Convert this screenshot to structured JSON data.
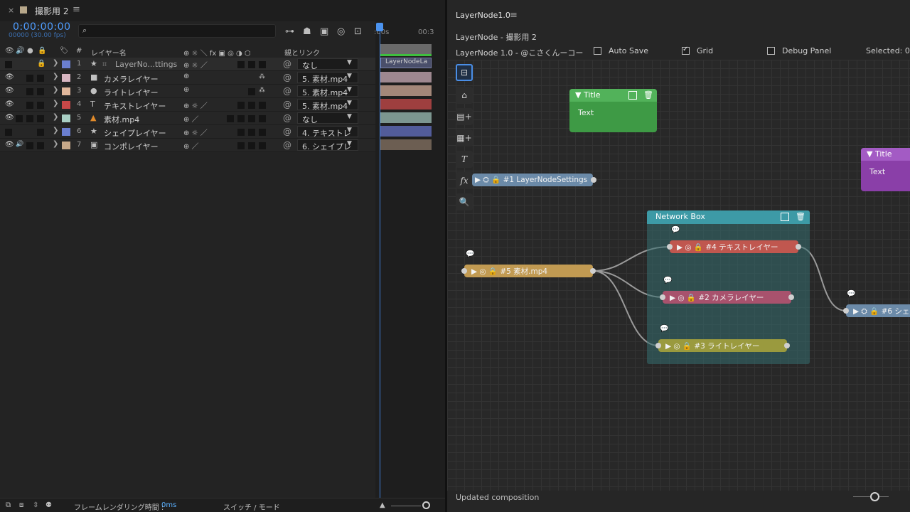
{
  "timeline": {
    "tab_close": "×",
    "tab_title": "撮影用 2",
    "tab_menu": "≡",
    "timecode": "0:00:00:00",
    "fps": "00000 (30.00 fps)",
    "header": {
      "eye": "👁",
      "audio": "🔊",
      "solo": "●",
      "lock": "🔒",
      "label": "🏷",
      "number": "#",
      "layer_name": "レイヤー名",
      "switches": "⊕ ☼ ＼ fx ▣ ◎ ◑ ⬡",
      "parent": "親とリンク"
    },
    "layers": [
      {
        "num": "1",
        "color": "#6b7fd0",
        "type_icon": "★",
        "type2": "⌗",
        "name": "LayerNo...ttings",
        "parent": "なし",
        "eye": "",
        "switch": "⊕ ☼ ／"
      },
      {
        "num": "2",
        "color": "#d8b6c2",
        "type_icon": "■",
        "name": "カメラレイヤー",
        "parent": "5. 素材.mp4",
        "eye": "👁",
        "switch": "⊕"
      },
      {
        "num": "3",
        "color": "#e1b79c",
        "type_icon": "●",
        "name": "ライトレイヤー",
        "parent": "5. 素材.mp4",
        "eye": "👁",
        "switch": "⊕"
      },
      {
        "num": "4",
        "color": "#c94848",
        "type_icon": "T",
        "name": "テキストレイヤー",
        "parent": "5. 素材.mp4",
        "eye": "👁",
        "switch": "⊕ ☼ ／"
      },
      {
        "num": "5",
        "color": "#a9cfc4",
        "type_icon": "▲",
        "name": "素材.mp4",
        "parent": "なし",
        "eye": "👁",
        "switch": "⊕   ／"
      },
      {
        "num": "6",
        "color": "#6b7fd0",
        "type_icon": "★",
        "name": "シェイプレイヤー",
        "parent": "4. テキストレ",
        "eye": "",
        "switch": "⊕ ☼ ／"
      },
      {
        "num": "7",
        "color": "#c7a98a",
        "type_icon": "▣",
        "name": "コンポレイヤー",
        "parent": "6. シェイプレ",
        "eye": "👁",
        "switch": "⊕   ／"
      }
    ],
    "ruler": {
      "t0": ":00s",
      "t1": "00:3"
    },
    "track_label": "LayerNodeLa",
    "bottom": {
      "render_label": "フレームレンダリング時間 :",
      "render_value": "0ms",
      "switch_mode": "スイッチ / モード"
    }
  },
  "editor": {
    "title": "LayerNode1.0",
    "menu": "≡",
    "comp_name": "LayerNode - 撮影用 2",
    "credit": "LayerNode 1.0 - @こさくんーコー",
    "auto_save": "Auto Save",
    "grid": "Grid",
    "debug_panel": "Debug Panel",
    "selected": "Selected: 0",
    "tools": [
      "⊟",
      "⌂",
      "▤+",
      "▦+",
      "T",
      "fx",
      "🔍"
    ],
    "cards": [
      {
        "title": "Title",
        "text": "Text",
        "color": "#3e9a45",
        "header": "#52b25a"
      },
      {
        "title": "Title",
        "text": "Text",
        "color": "#8a3fa8",
        "header": "#a35bc4"
      }
    ],
    "network_box": "Network Box",
    "nodes": {
      "settings": "#1 LayerNodeSettings",
      "src": "#5 素材.mp4",
      "text": "#4 テキストレイヤー",
      "camera": "#2 カメラレイヤー",
      "light": "#3 ライトレイヤー",
      "shape": "#6 シェ"
    },
    "status": "Updated composition"
  }
}
